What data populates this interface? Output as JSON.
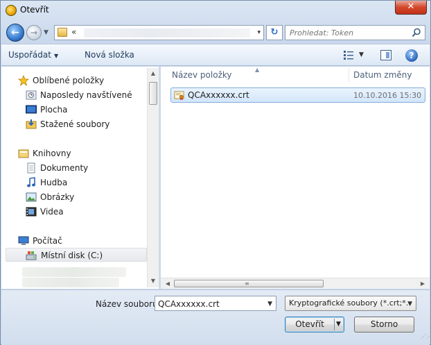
{
  "window": {
    "title": "Otevřít",
    "close_label": "✕"
  },
  "address": {
    "chevron": "«",
    "dropdown_caret": "▾"
  },
  "search": {
    "placeholder": "Prohledat: Token"
  },
  "toolbar": {
    "organize_label": "Uspořádat",
    "new_folder_label": "Nová složka",
    "help_label": "?"
  },
  "nav": {
    "favorites": {
      "label": "Oblíbené položky",
      "items": [
        {
          "label": "Naposledy navštívené",
          "icon": "recent-places-icon"
        },
        {
          "label": "Plocha",
          "icon": "desktop-icon"
        },
        {
          "label": "Stažené soubory",
          "icon": "downloads-icon"
        }
      ]
    },
    "libraries": {
      "label": "Knihovny",
      "items": [
        {
          "label": "Dokumenty",
          "icon": "documents-icon"
        },
        {
          "label": "Hudba",
          "icon": "music-icon"
        },
        {
          "label": "Obrázky",
          "icon": "pictures-icon"
        },
        {
          "label": "Videa",
          "icon": "videos-icon"
        }
      ]
    },
    "computer": {
      "label": "Počítač",
      "items": [
        {
          "label": "Místní disk (C:)",
          "icon": "local-disk-icon",
          "selected": true
        }
      ]
    }
  },
  "files": {
    "columns": {
      "name": "Název položky",
      "date": "Datum změny"
    },
    "rows": [
      {
        "name": "QCAxxxxxx.crt",
        "date": "10.10.2016 15:30",
        "icon": "certificate-icon",
        "selected": true
      }
    ]
  },
  "footer": {
    "filename_label": "Název souboru:",
    "filename_value": "QCAxxxxxx.crt",
    "filetype_value": "Kryptografické soubory (*.crt;*.",
    "open_label": "Otevřít",
    "cancel_label": "Storno"
  },
  "colors": {
    "selection": "#d2e6fb",
    "selection_border": "#84acdd",
    "close_button": "#d3462a",
    "accent": "#2a65b8"
  }
}
